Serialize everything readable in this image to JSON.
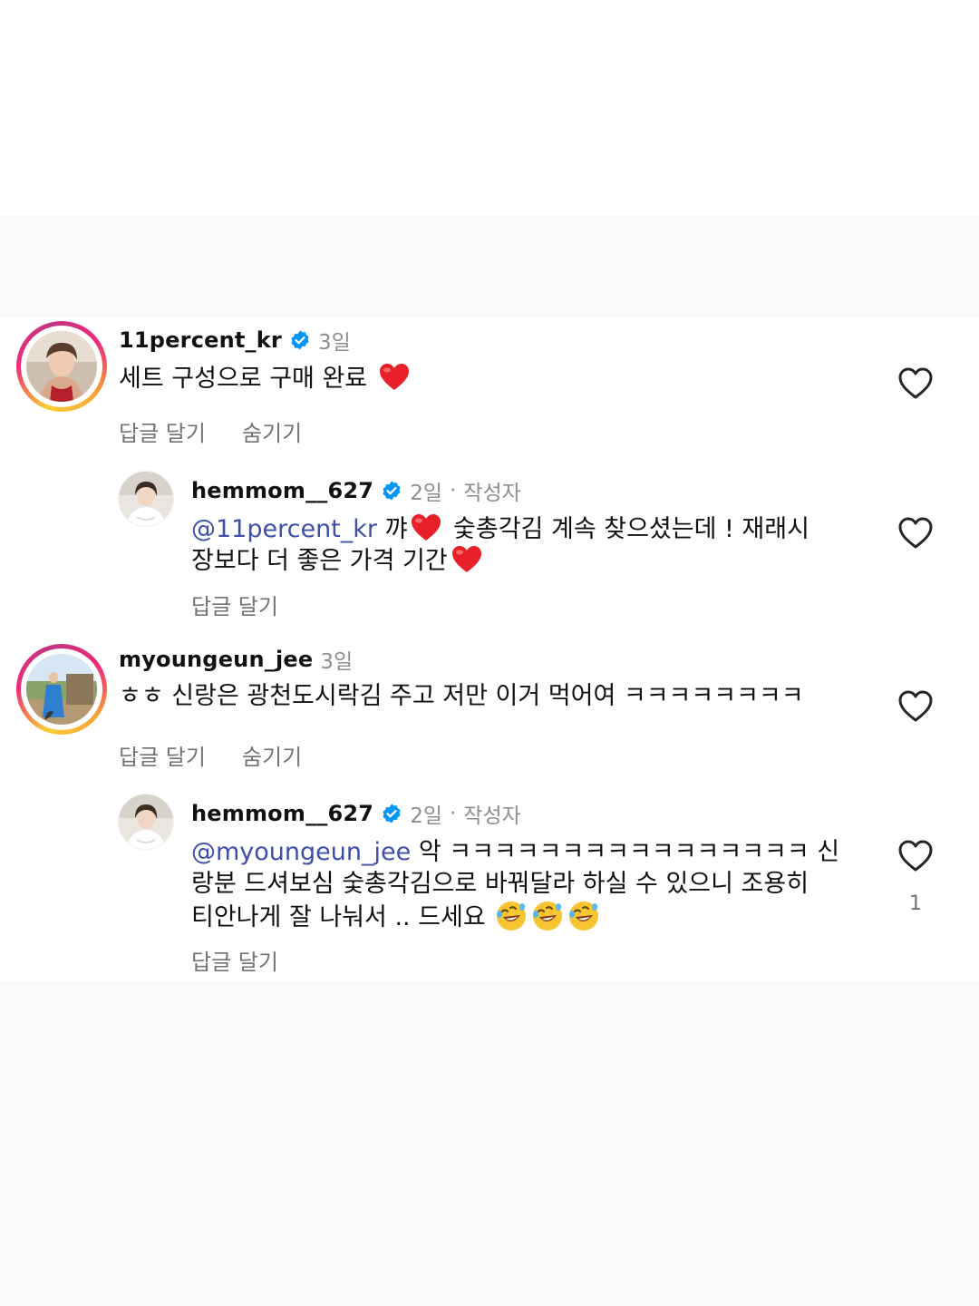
{
  "comments": [
    {
      "username": "11percent_kr",
      "time": "3일",
      "text_before": "세트 구성으로 구매 완료",
      "reply_label": "답글 달기",
      "hide_label": "숨기기"
    },
    {
      "username": "hemmom__627",
      "time": "2일",
      "separator": "·",
      "author_label": "작성자",
      "mention": "@11percent_kr",
      "text_line1_part1": " 꺄",
      "text_line1_part2": " 숯총각김 계속 찾으셨는데 ! 재래시",
      "text_line2": "장보다 더 좋은 가격 기간",
      "reply_label": "답글 달기"
    },
    {
      "username": "myoungeun_jee",
      "time": "3일",
      "text": "ㅎㅎ 신랑은 광천도시락김 주고 저만 이거 먹어여 ㅋㅋㅋㅋㅋㅋㅋㅋ",
      "reply_label": "답글 달기",
      "hide_label": "숨기기"
    },
    {
      "username": "hemmom__627",
      "time": "2일",
      "separator": "·",
      "author_label": "작성자",
      "mention": "@myoungeun_jee",
      "text_line1": " 악 ㅋㅋㅋㅋㅋㅋㅋㅋㅋㅋㅋㅋㅋㅋㅋㅋ 신",
      "text_line2": "랑분 드셔보심 숯총각김으로 바꿔달라 하실 수 있으니 조용히",
      "text_line3": "티안나게 잘 나눠서 .. 드세요",
      "reply_label": "답글 달기",
      "like_count": "1"
    }
  ],
  "colors": {
    "mention": "#3d4fa8",
    "verified": "#0095f6",
    "muted": "#8e8e8e",
    "band": "#fafafa"
  },
  "icons": {
    "verified": "verified-badge-icon",
    "heart": "heart-outline-icon",
    "emoji_heart": "red-heart-emoji",
    "emoji_laugh": "rolling-on-floor-laughing-emoji"
  }
}
